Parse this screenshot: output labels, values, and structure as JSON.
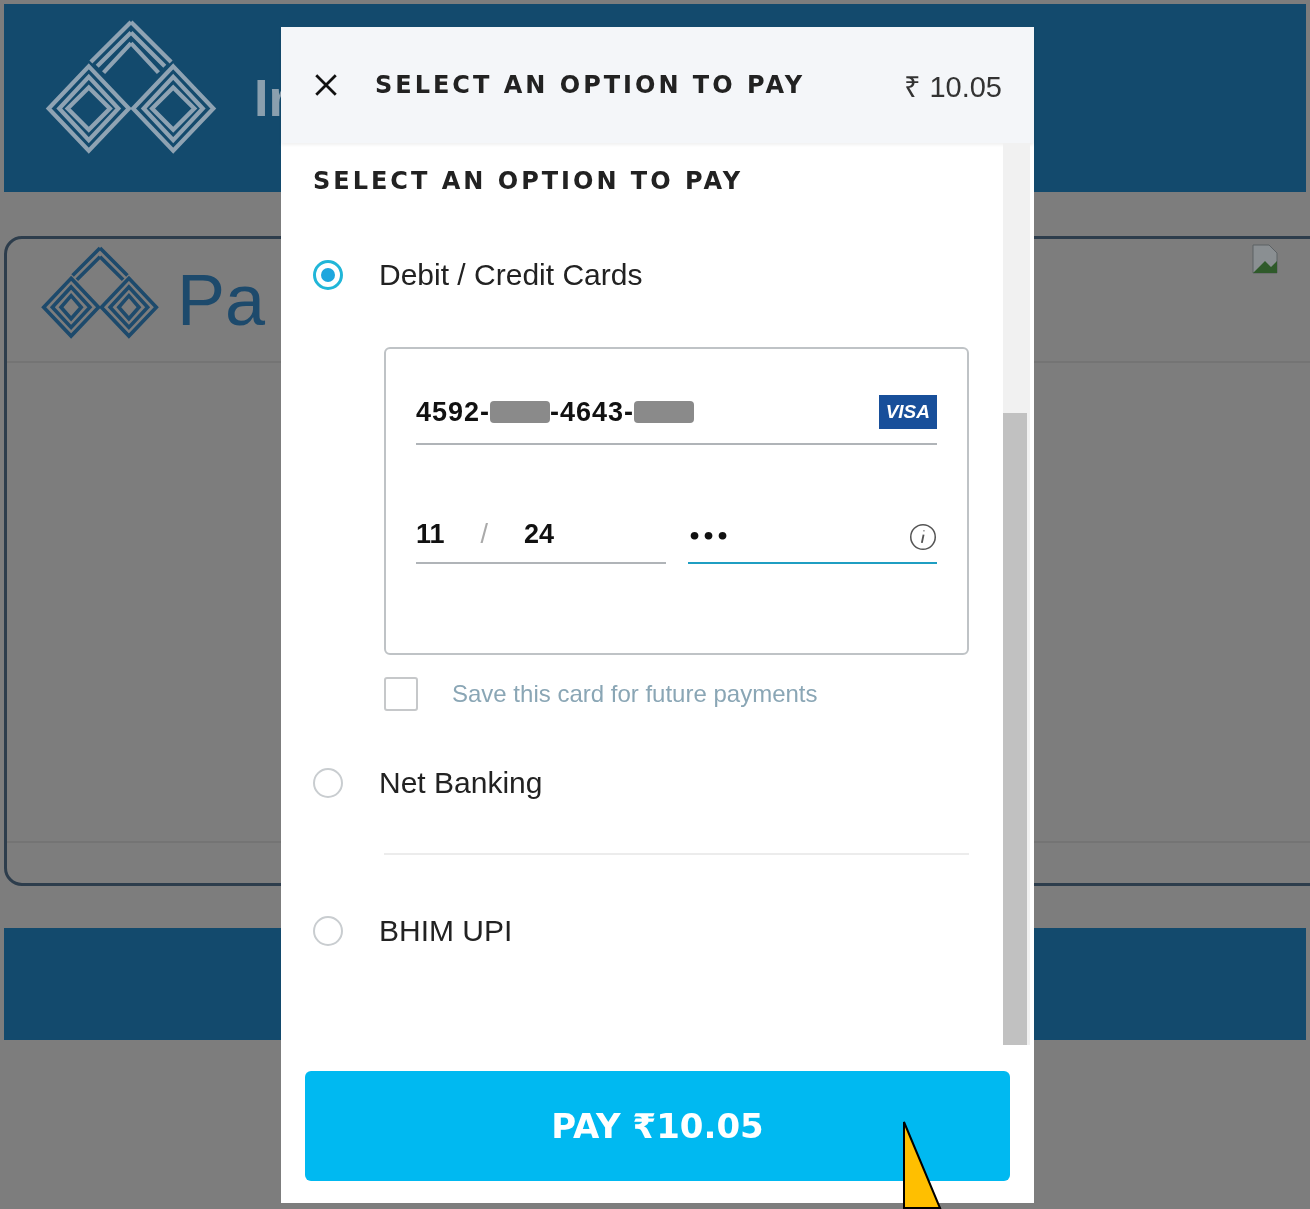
{
  "background": {
    "brand": "Ir",
    "page_title": "Pa"
  },
  "modal": {
    "title": "SELECT AN OPTION TO PAY",
    "amount": "₹ 10.05",
    "section_title": "SELECT AN OPTION TO PAY",
    "options": [
      {
        "label": "Debit / Credit Cards",
        "selected": true
      },
      {
        "label": "Net Banking",
        "selected": false
      },
      {
        "label": "BHIM UPI",
        "selected": false
      }
    ],
    "card": {
      "number": [
        {
          "kind": "digits",
          "text": "4592-"
        },
        {
          "kind": "redacted"
        },
        {
          "kind": "digits",
          "text": "-4643-"
        },
        {
          "kind": "redacted"
        }
      ],
      "brand": "VISA",
      "expiry_month": "11",
      "separator": "/",
      "expiry_year": "24",
      "cvv": "•••"
    },
    "save_card": {
      "label": "Save this card for future payments",
      "checked": false
    },
    "pay_button": "PAY ₹10.05"
  }
}
